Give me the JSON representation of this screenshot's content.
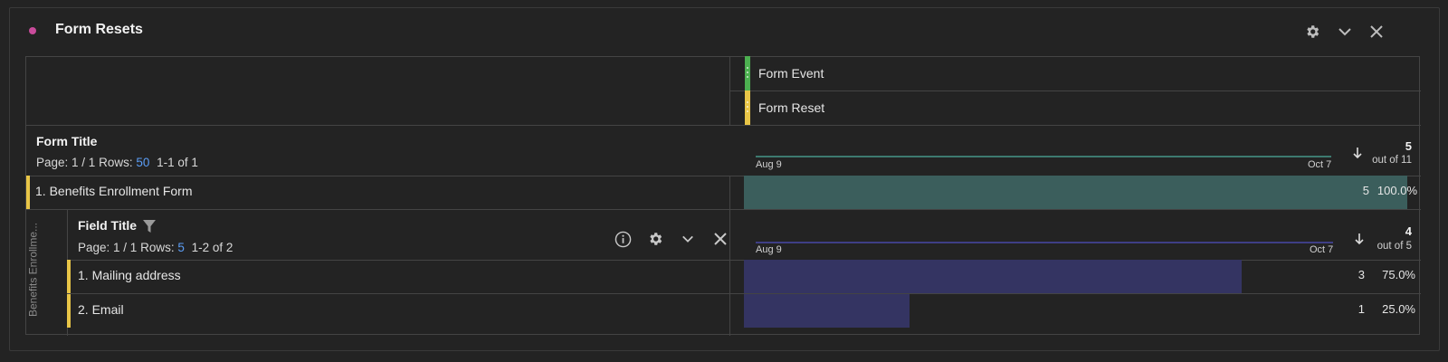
{
  "panel": {
    "title": "Form Resets",
    "dot_color": "#c94b9b",
    "icons": [
      "gear-icon",
      "chevron-down-icon",
      "close-icon"
    ]
  },
  "metrics": [
    {
      "label": "Form Event",
      "color": "#4caf50"
    },
    {
      "label": "Form Reset",
      "color": "#e8c547"
    }
  ],
  "top_table": {
    "dimension": "Form Title",
    "page_label": "Page: 1 / 1",
    "rows_label": "Rows:",
    "rows_value": "50",
    "range": "1-1 of 1",
    "spark_start": "Aug 9",
    "spark_end": "Oct 7",
    "spark_color": "#3d7a6f",
    "total": "5",
    "total_of": "out of 11",
    "rows": [
      {
        "label": "1.  Benefits Enrollment Form",
        "count": "5",
        "percent": "100.0%",
        "fraction": 1.0
      }
    ],
    "bar_color": "#3b5e5c"
  },
  "breakdown": {
    "vertical_label": "Benefits Enrollme...",
    "dimension": "Field Title",
    "page_label": "Page: 1 / 1",
    "rows_label": "Rows:",
    "rows_value": "5",
    "range": "1-2 of 2",
    "spark_start": "Aug 9",
    "spark_end": "Oct 7",
    "spark_color": "#3e3e86",
    "total": "4",
    "total_of": "out of 5",
    "bar_color": "#343462",
    "rows": [
      {
        "label": "1.  Mailing address",
        "count": "3",
        "percent": "75.0%",
        "fraction": 0.75
      },
      {
        "label": "2.  Email",
        "count": "1",
        "percent": "25.0%",
        "fraction": 0.25
      }
    ]
  }
}
